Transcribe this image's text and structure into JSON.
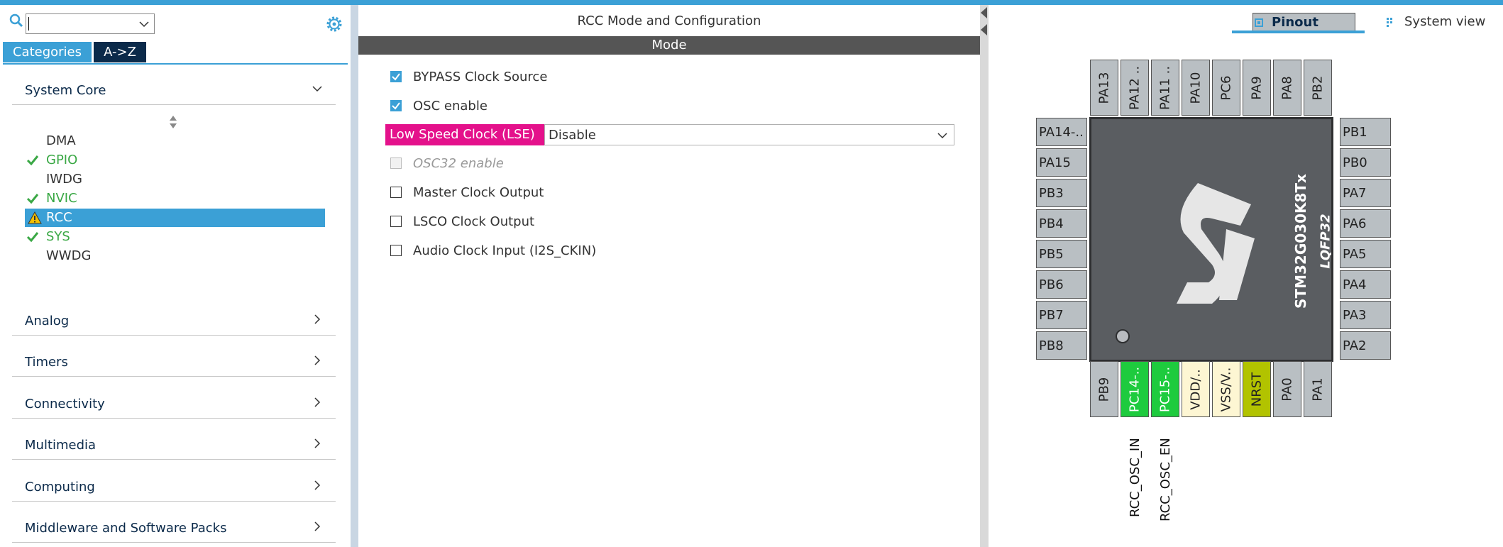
{
  "left_panel": {
    "search": {
      "value": ""
    },
    "tabs": {
      "categories": "Categories",
      "atoz": "A->Z"
    },
    "system_core": {
      "label": "System Core",
      "items": [
        {
          "label": "DMA",
          "status": "none"
        },
        {
          "label": "GPIO",
          "status": "ok"
        },
        {
          "label": "IWDG",
          "status": "none"
        },
        {
          "label": "NVIC",
          "status": "ok"
        },
        {
          "label": "RCC",
          "status": "warning",
          "selected": true
        },
        {
          "label": "SYS",
          "status": "ok"
        },
        {
          "label": "WWDG",
          "status": "none"
        }
      ]
    },
    "groups": [
      "Analog",
      "Timers",
      "Connectivity",
      "Multimedia",
      "Computing",
      "Middleware and Software Packs"
    ]
  },
  "config_panel": {
    "title": "RCC Mode and Configuration",
    "section": "Mode",
    "bypass": {
      "label": "BYPASS Clock Source",
      "checked": true
    },
    "osc_enable": {
      "label": "OSC enable",
      "checked": true
    },
    "lse": {
      "label": "Low Speed Clock (LSE)",
      "value": "Disable"
    },
    "osc32": {
      "label": "OSC32 enable",
      "checked": false,
      "disabled": true
    },
    "mco": {
      "label": "Master Clock Output",
      "checked": false
    },
    "lsco": {
      "label": "LSCO Clock Output",
      "checked": false
    },
    "audio": {
      "label": "Audio Clock Input (I2S_CKIN)",
      "checked": false
    }
  },
  "pinout_panel": {
    "tabs": {
      "pinout": "Pinout view",
      "system": "System view"
    },
    "chip": {
      "name": "STM32G030K8Tx",
      "package": "LQFP32"
    },
    "pins": {
      "top": [
        "PA13",
        "PA12 ..",
        "PA11 ..",
        "PA10",
        "PC6",
        "PA9",
        "PA8",
        "PB2"
      ],
      "left": [
        "PA14-..",
        "PA15",
        "PB3",
        "PB4",
        "PB5",
        "PB6",
        "PB7",
        "PB8"
      ],
      "right": [
        "PB1",
        "PB0",
        "PA7",
        "PA6",
        "PA5",
        "PA4",
        "PA3",
        "PA2"
      ],
      "bottom": [
        "PB9",
        "PC14-..",
        "PC15-..",
        "VDD/..",
        "VSS/V..",
        "NRST",
        "PA0",
        "PA1"
      ]
    },
    "signals": {
      "pc14": "RCC_OSC_IN",
      "pc15": "RCC_OSC_EN"
    },
    "colors": {
      "active_pin": "#1ecb3e",
      "power_pin": "#fdf6d3",
      "reset_pin": "#b2c300",
      "default_pin": "#b9bfc3"
    }
  }
}
